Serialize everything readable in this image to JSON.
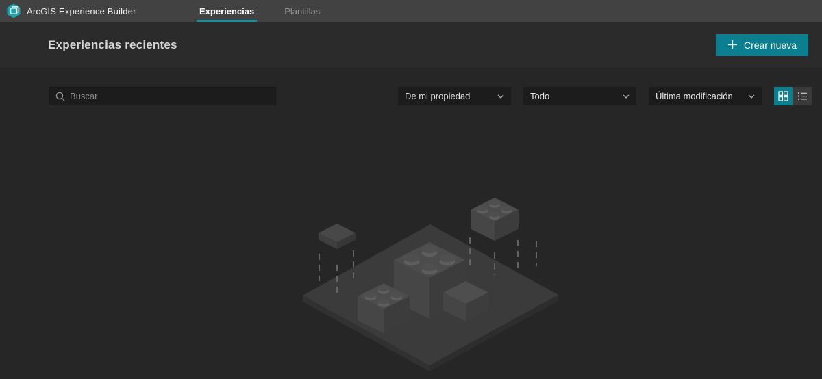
{
  "app": {
    "title": "ArcGIS Experience Builder",
    "tabs": [
      {
        "label": "Experiencias",
        "active": true
      },
      {
        "label": "Plantillas",
        "active": false
      }
    ]
  },
  "header": {
    "title": "Experiencias recientes",
    "create_button_label": "Crear nueva"
  },
  "filters": {
    "search_placeholder": "Buscar",
    "dropdowns": [
      {
        "value": "De mi propiedad"
      },
      {
        "value": "Todo"
      },
      {
        "value": "Última modificación"
      }
    ],
    "view_modes": [
      {
        "name": "grid",
        "active": true
      },
      {
        "name": "list",
        "active": false
      }
    ]
  },
  "icons": {
    "logo": "experience-builder-logo",
    "search": "search-icon",
    "chevron": "chevron-down-icon",
    "plus": "plus-icon",
    "grid": "grid-view-icon",
    "list": "list-view-icon"
  },
  "colors": {
    "accent": "#0b7e90",
    "tab_underline": "#1a8f9c",
    "logo_teal": "#1ba3b2",
    "topbar_bg": "#424242",
    "header_bg": "#2b2b2b",
    "content_bg": "#262626",
    "field_bg": "#1c1c1c"
  },
  "empty_state": {
    "illustration": "isometric-building-bricks"
  }
}
